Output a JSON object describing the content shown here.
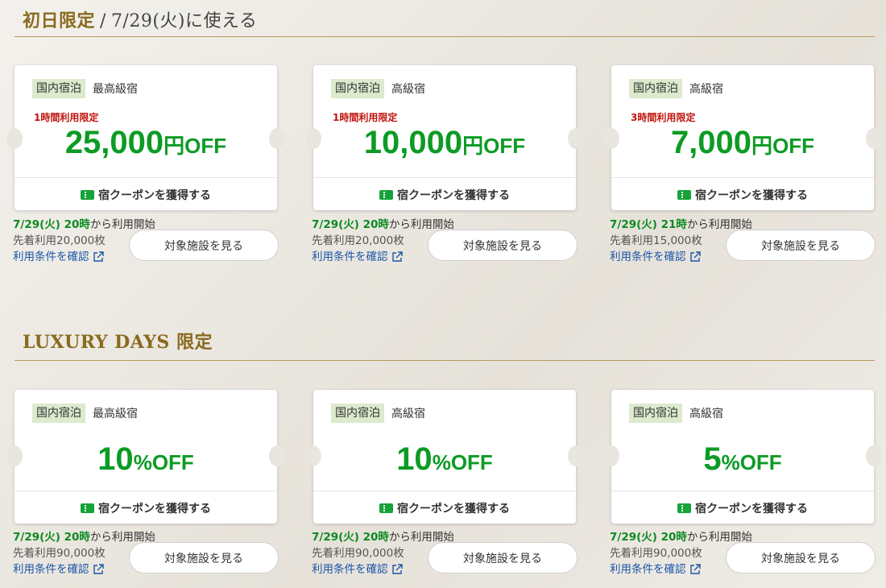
{
  "section1": {
    "title_main": "初日限定",
    "separator": "/",
    "title_sub": "7/29(火)に使える",
    "cards": [
      {
        "category": "国内宿泊",
        "grade": "最高級宿",
        "limit": "1時間利用限定",
        "amount": "25,000",
        "unit": "円",
        "off": "OFF",
        "get_label": "宿クーポンを獲得する",
        "start_date": "7/29(火) 20時",
        "start_suffix": "から利用開始",
        "stock": "先着利用20,000枚",
        "terms": "利用条件を確認",
        "view_button": "対象施設を見る"
      },
      {
        "category": "国内宿泊",
        "grade": "高級宿",
        "limit": "1時間利用限定",
        "amount": "10,000",
        "unit": "円",
        "off": "OFF",
        "get_label": "宿クーポンを獲得する",
        "start_date": "7/29(火) 20時",
        "start_suffix": "から利用開始",
        "stock": "先着利用20,000枚",
        "terms": "利用条件を確認",
        "view_button": "対象施設を見る"
      },
      {
        "category": "国内宿泊",
        "grade": "高級宿",
        "limit": "3時間利用限定",
        "amount": "7,000",
        "unit": "円",
        "off": "OFF",
        "get_label": "宿クーポンを獲得する",
        "start_date": "7/29(火) 21時",
        "start_suffix": "から利用開始",
        "stock": "先着利用15,000枚",
        "terms": "利用条件を確認",
        "view_button": "対象施設を見る"
      }
    ]
  },
  "section2": {
    "title": "LUXURY DAYS 限定",
    "cards": [
      {
        "category": "国内宿泊",
        "grade": "最高級宿",
        "amount": "10",
        "unit": "%",
        "off": "OFF",
        "get_label": "宿クーポンを獲得する",
        "start_date": "7/29(火) 20時",
        "start_suffix": "から利用開始",
        "stock": "先着利用90,000枚",
        "terms": "利用条件を確認",
        "view_button": "対象施設を見る"
      },
      {
        "category": "国内宿泊",
        "grade": "高級宿",
        "amount": "10",
        "unit": "%",
        "off": "OFF",
        "get_label": "宿クーポンを獲得する",
        "start_date": "7/29(火) 20時",
        "start_suffix": "から利用開始",
        "stock": "先着利用90,000枚",
        "terms": "利用条件を確認",
        "view_button": "対象施設を見る"
      },
      {
        "category": "国内宿泊",
        "grade": "高級宿",
        "amount": "5",
        "unit": "%",
        "off": "OFF",
        "get_label": "宿クーポンを獲得する",
        "start_date": "7/29(火) 20時",
        "start_suffix": "から利用開始",
        "stock": "先着利用90,000枚",
        "terms": "利用条件を確認",
        "view_button": "対象施設を見る"
      }
    ]
  },
  "colors": {
    "accent_gold": "#8a6a1f",
    "discount_green": "#0c9b24",
    "limit_red": "#c0130c",
    "link_blue": "#1a56a8"
  },
  "icons": {
    "ticket": "ticket-icon",
    "external": "external-link-icon"
  }
}
